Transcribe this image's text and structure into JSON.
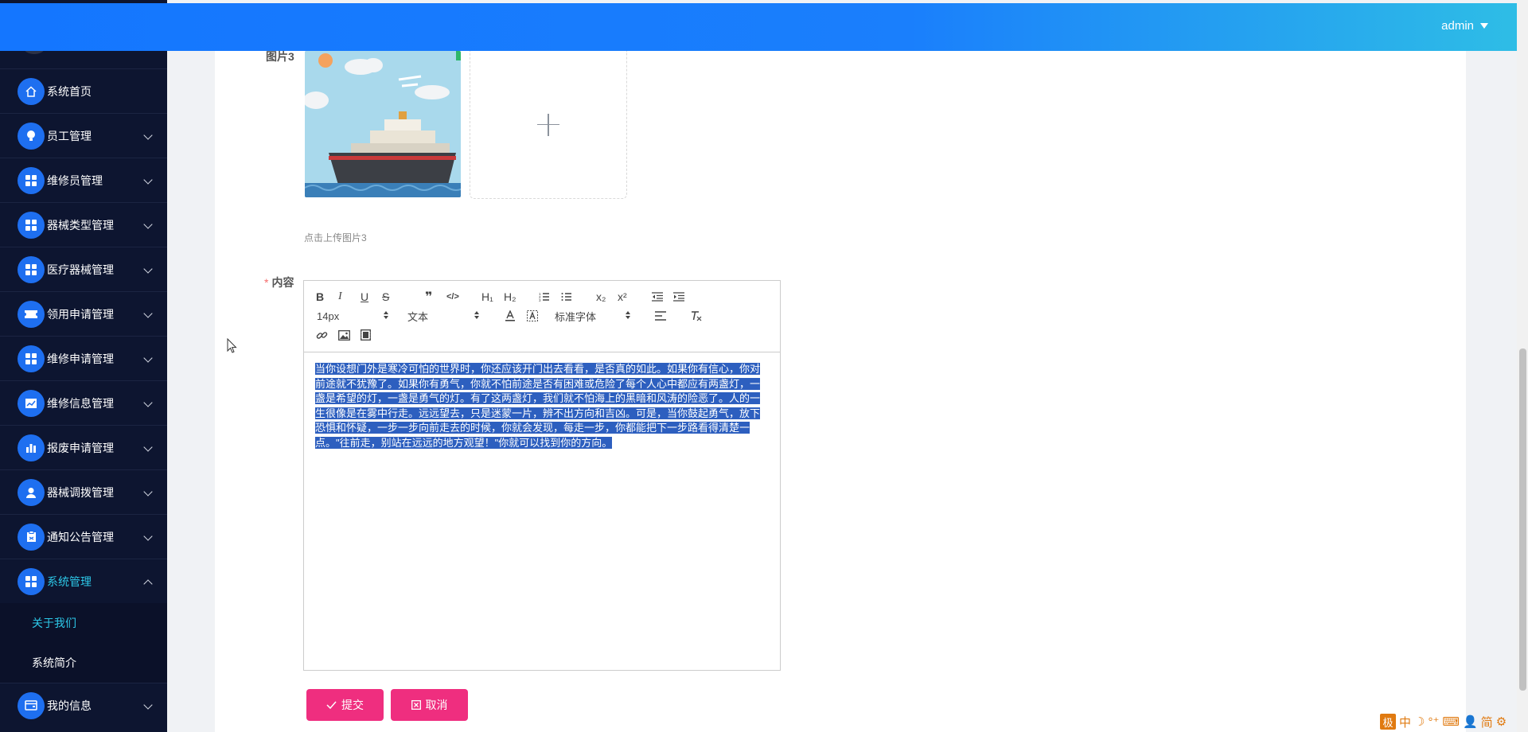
{
  "header": {
    "user": "admin"
  },
  "sidebar": {
    "items": [
      {
        "label": "系统首页",
        "icon": "home-icon"
      },
      {
        "label": "员工管理",
        "icon": "bulb-icon"
      },
      {
        "label": "维修员管理",
        "icon": "grid-icon"
      },
      {
        "label": "器械类型管理",
        "icon": "grid-icon"
      },
      {
        "label": "医疗器械管理",
        "icon": "grid-icon"
      },
      {
        "label": "领用申请管理",
        "icon": "ticket-icon"
      },
      {
        "label": "维修申请管理",
        "icon": "grid-icon"
      },
      {
        "label": "维修信息管理",
        "icon": "chart-icon"
      },
      {
        "label": "报废申请管理",
        "icon": "bar-chart-icon"
      },
      {
        "label": "器械调拨管理",
        "icon": "user-icon"
      },
      {
        "label": "通知公告管理",
        "icon": "clipboard-icon"
      },
      {
        "label": "系统管理",
        "icon": "grid-icon"
      },
      {
        "label": "我的信息",
        "icon": "wallet-icon"
      }
    ],
    "sub_items": [
      {
        "label": "关于我们",
        "active": true
      },
      {
        "label": "系统简介",
        "active": false
      }
    ],
    "active_color": "#2dc8e8"
  },
  "form": {
    "image_label": "图片3",
    "upload_tip": "点击上传图片3",
    "content_label": "内容",
    "required_mark": "*"
  },
  "editor": {
    "toolbar": {
      "bold": "B",
      "italic": "I",
      "underline": "U",
      "strike": "S",
      "quote": "❞",
      "code": "</>",
      "h1": "H₁",
      "h2": "H₂",
      "sub": "x₂",
      "sup": "x²",
      "size": "14px",
      "header_select": "文本",
      "font_select": "标准字体"
    },
    "text_lines": [
      "当你设想门外是寒冷可怕的世界时，你还应该开门出去看看，是否真的如此。如果你有信心，你对",
      "前途就不犹豫了。如果你有勇气，你就不怕前途是否有困难或危险了每个人心中都应有两盏灯，一",
      "盏是希望的灯，一盏是勇气的灯。有了这两盏灯，我们就不怕海上的黑暗和风涛的险恶了。人的一",
      "生很像是在雾中行走。远远望去，只是迷蒙一片，辨不出方向和吉凶。可是，当你鼓起勇气，放下",
      "恐惧和怀疑，一步一步向前走去的时候，你就会发现，每走一步，你都能把下一步路看得清楚一",
      "点。\"往前走，别站在远远的地方观望！\"你就可以找到你的方向。"
    ]
  },
  "buttons": {
    "submit": "提交",
    "cancel": "取消",
    "color": "#ef2e7f"
  },
  "ime": {
    "logo": "极",
    "items": [
      "中",
      "☽",
      "°⁺",
      "⌨",
      "👤",
      "简",
      "⚙"
    ]
  }
}
